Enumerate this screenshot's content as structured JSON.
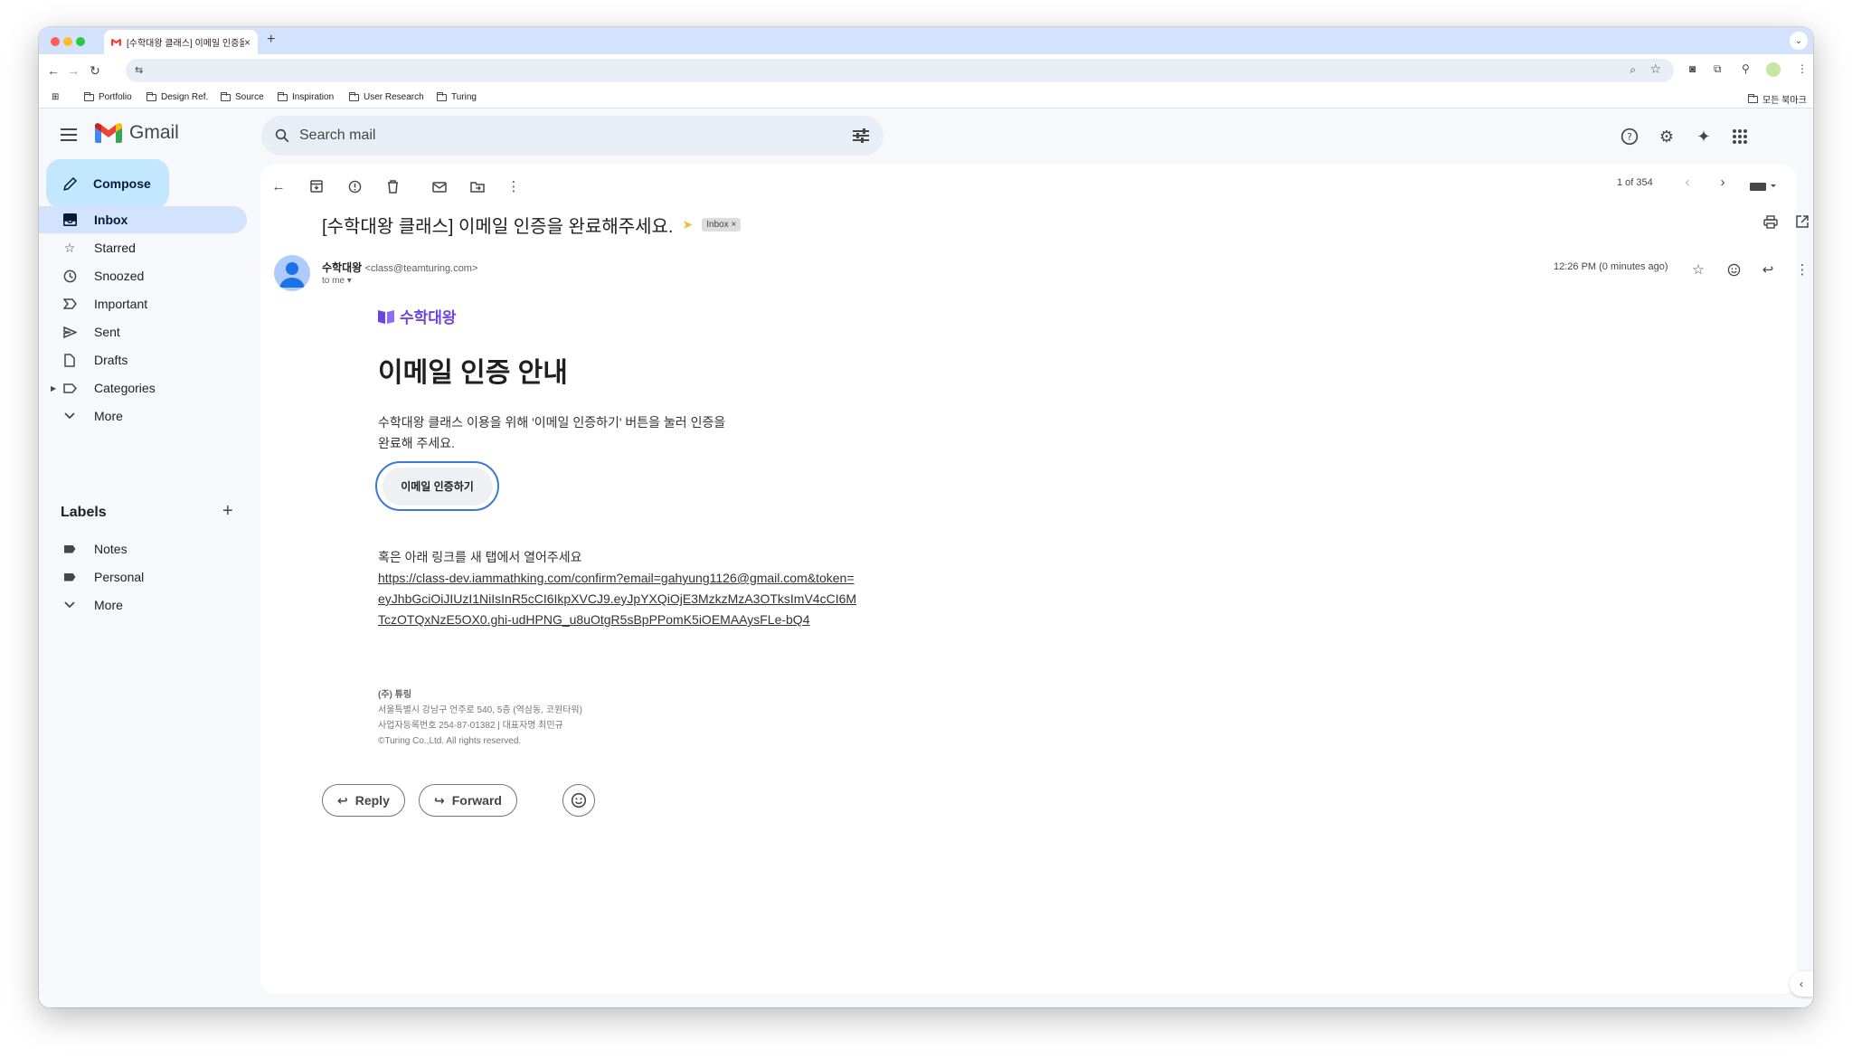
{
  "browser": {
    "tab_title": "[수학대왕 클래스] 이메일 인증을 완",
    "bookmarks": [
      "Portfolio",
      "Design Ref.",
      "Source",
      "Inspiration",
      "User Research",
      "Turing"
    ],
    "all_bookmarks": "모든 북마크"
  },
  "gmail": {
    "logo": "Gmail",
    "search_placeholder": "Search mail",
    "compose": "Compose",
    "nav": [
      {
        "label": "Inbox",
        "icon": "inbox-icon"
      },
      {
        "label": "Starred",
        "icon": "star-icon"
      },
      {
        "label": "Snoozed",
        "icon": "clock-icon"
      },
      {
        "label": "Important",
        "icon": "important-icon"
      },
      {
        "label": "Sent",
        "icon": "send-icon"
      },
      {
        "label": "Drafts",
        "icon": "draft-icon"
      },
      {
        "label": "Categories",
        "icon": "label-outline-icon"
      },
      {
        "label": "More",
        "icon": "chevron-down-icon"
      }
    ],
    "labels_heading": "Labels",
    "labels": [
      {
        "label": "Notes"
      },
      {
        "label": "Personal"
      },
      {
        "label": "More"
      }
    ],
    "pager": "1 of 354"
  },
  "email": {
    "subject": "[수학대왕 클래스] 이메일 인증을 완료해주세요.",
    "inbox_chip": "Inbox ×",
    "sender_name": "수학대왕",
    "sender_email": "<class@teamturing.com>",
    "to": "to me",
    "time": "12:26 PM (0 minutes ago)",
    "brand": "수학대왕",
    "heading": "이메일 인증 안내",
    "body_line1": "수학대왕 클래스 이용을 위해 '이메일 인증하기' 버튼을 눌러 인증을",
    "body_line2": "완료해 주세요.",
    "verify_button": "이메일 인증하기",
    "link_intro": "혹은 아래 링크를 새 탭에서 열어주세요",
    "link": "https://class-dev.iammathking.com/confirm?email=gahyung1126@gmail.com&token=eyJhbGciOiJIUzI1NiIsInR5cCI6IkpXVCJ9.eyJpYXQiOjE3MzkzMzA3OTksImV4cCI6MTczOTQxNzE5OX0.ghi-udHPNG_u8uOtgR5sBpPPomK5iOEMAAysFLe-bQ4",
    "footer_company": "(주) 튜링",
    "footer_address": "서울특별시 강남구 언주로 540, 5층 (역삼동, 코원타워)",
    "footer_reg": "사업자등록번호 254-87-01382 | 대표자명 최민규",
    "footer_copy": "©Turing Co.,Ltd. All rights reserved.",
    "reply": "Reply",
    "forward": "Forward"
  }
}
